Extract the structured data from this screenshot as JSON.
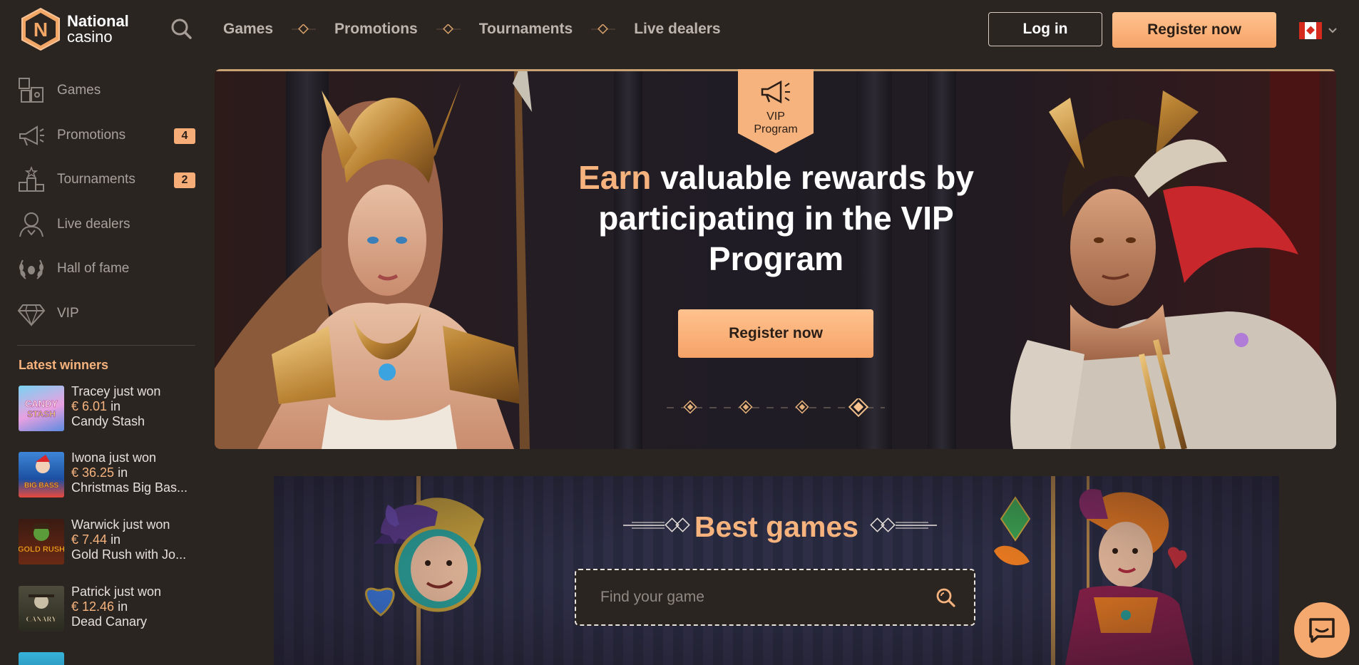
{
  "brand": {
    "name_line1": "National",
    "name_line2": "casino",
    "logo_letter": "N"
  },
  "header": {
    "nav": [
      "Games",
      "Promotions",
      "Tournaments",
      "Live dealers"
    ],
    "login_label": "Log in",
    "register_label": "Register now",
    "language_flag": "canada-flag"
  },
  "sidebar": {
    "items": [
      {
        "label": "Games",
        "icon": "puzzle-icon"
      },
      {
        "label": "Promotions",
        "icon": "megaphone-icon",
        "badge": "4"
      },
      {
        "label": "Tournaments",
        "icon": "podium-icon",
        "badge": "2"
      },
      {
        "label": "Live dealers",
        "icon": "dealer-icon"
      },
      {
        "label": "Hall of fame",
        "icon": "laurel-icon"
      },
      {
        "label": "VIP",
        "icon": "diamond-icon"
      }
    ],
    "winners_title": "Latest winners",
    "winners": [
      {
        "name": "Tracey just won",
        "amount": "€ 6.01",
        "in": "in",
        "game": "Candy Stash"
      },
      {
        "name": "Iwona just won",
        "amount": "€ 36.25",
        "in": "in",
        "game": "Christmas Big Bas..."
      },
      {
        "name": "Warwick just won",
        "amount": "€ 7.44",
        "in": "in",
        "game": "Gold Rush with Jo..."
      },
      {
        "name": "Patrick just won",
        "amount": "€ 12.46",
        "in": "in",
        "game": "Dead Canary"
      }
    ]
  },
  "hero": {
    "vip_badge_line1": "VIP",
    "vip_badge_line2": "Program",
    "title_accent": "Earn",
    "title_rest": "valuable rewards by participating in the VIP Program",
    "cta_label": "Register now",
    "slides_total": 4,
    "active_slide": 4
  },
  "best_games": {
    "title": "Best games",
    "search_placeholder": "Find your game"
  },
  "colors": {
    "accent": "#f6b37d",
    "background": "#2b2522",
    "button": "#f6a96f"
  }
}
